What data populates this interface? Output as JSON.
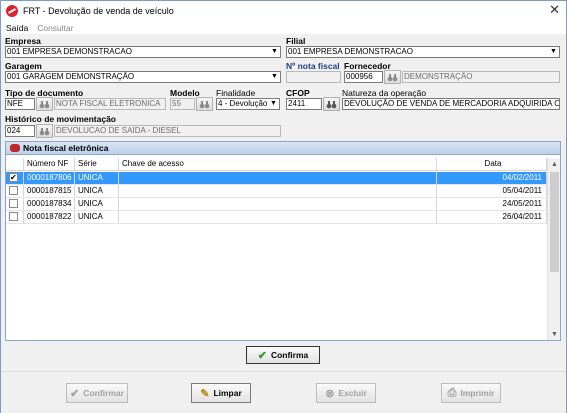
{
  "window": {
    "title": "FRT - Devolução de venda de veículo",
    "close": "✕"
  },
  "menu": {
    "items": [
      "Saída",
      "Consultar"
    ]
  },
  "form": {
    "empresa_label": "Empresa",
    "empresa_value": "001 EMPRESA DEMONSTRACAO",
    "filial_label": "Filial",
    "filial_value": "001 EMPRESA DEMONSTRACAO",
    "garagem_label": "Garagem",
    "garagem_value": "001 GARAGEM DEMONSTRAÇÃO",
    "nota_fiscal_label": "Nº nota fiscal",
    "nota_fiscal_value": "",
    "fornecedor_label": "Fornecedor",
    "fornecedor_code": "000956",
    "fornecedor_name": "DEMONSTRAÇÃO",
    "tipo_documento_label": "Tipo de documento",
    "tipo_documento_code": "NFE",
    "tipo_documento_name": "NOTA FISCAL ELETRONICA",
    "modelo_label": "Modelo",
    "modelo_value": "55",
    "finalidade_label": "Finalidade",
    "finalidade_value": "4 - Devolução",
    "cfop_label": "CFOP",
    "cfop_value": "2411",
    "natureza_label": "Natureza da operação",
    "natureza_value": "DEVOLUÇÃO DE VENDA DE MERCADORIA ADQUIRIDA OU",
    "historico_label": "Histórico de movimentação",
    "historico_code": "024",
    "historico_name": "DEVOLUCAO DE SAIDA - DIESEL"
  },
  "grid": {
    "title": "Nota fiscal eletrônica",
    "columns": [
      "Número NF",
      "Série",
      "Chave de acesso",
      "Data"
    ],
    "rows": [
      {
        "checked": true,
        "numero": "0000187806",
        "serie": "UNICA",
        "chave": "",
        "data": "04/02/2011"
      },
      {
        "checked": false,
        "numero": "0000187815",
        "serie": "UNICA",
        "chave": "",
        "data": "05/04/2011"
      },
      {
        "checked": false,
        "numero": "0000187834",
        "serie": "UNICA",
        "chave": "",
        "data": "24/05/2011"
      },
      {
        "checked": false,
        "numero": "0000187822",
        "serie": "UNICA",
        "chave": "",
        "data": "26/04/2011"
      }
    ]
  },
  "buttons": {
    "confirma": "Confirma",
    "confirmar": "Confirmar",
    "limpar": "Limpar",
    "excluir": "Excluir",
    "imprimir": "Imprimir"
  }
}
